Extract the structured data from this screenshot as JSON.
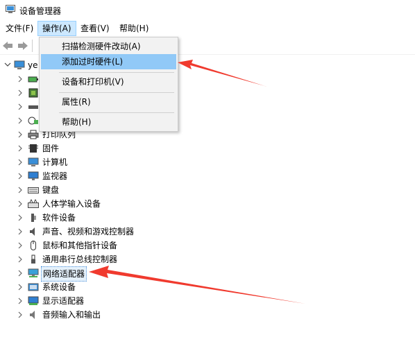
{
  "window": {
    "title": "设备管理器"
  },
  "menubar": {
    "items": [
      "文件(F)",
      "操作(A)",
      "查看(V)",
      "帮助(H)"
    ]
  },
  "tree": {
    "root": "ye",
    "items": [
      "打印队列",
      "固件",
      "计算机",
      "监视器",
      "键盘",
      "人体学输入设备",
      "软件设备",
      "声音、视频和游戏控制器",
      "鼠标和其他指针设备",
      "通用串行总线控制器",
      "网络适配器",
      "系统设备",
      "显示适配器",
      "音频输入和输出"
    ]
  },
  "dropdown": {
    "items": [
      "扫描检测硬件改动(A)",
      "添加过时硬件(L)",
      "设备和打印机(V)",
      "属性(R)",
      "帮助(H)"
    ],
    "highlighted_index": 1
  },
  "colors": {
    "menu_active": "#cce8ff",
    "dropdown_highlight": "#91c9f7",
    "arrow": "#f03a2e"
  }
}
